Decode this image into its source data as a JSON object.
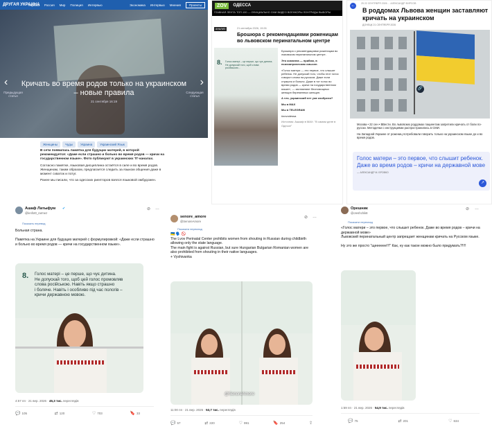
{
  "panel_a": {
    "nav": [
      "Україна",
      "Россия",
      "Мир",
      "Полиция",
      "Интервью"
    ],
    "logo": "ДРУГАЯ УКРАИНА",
    "nav_right": [
      "Экономика",
      "Интервью",
      "Мнения"
    ],
    "nav_button": "Проекты",
    "hero_title": "Кричать во время родов только на украинском – новые правила",
    "hero_date": "21 сентября 16:19",
    "prev_label": "Предыдущая статья",
    "next_label": "Следующая статья",
    "tags": [
      "Женщины",
      "Чуды",
      "Украина",
      "Украинский Язык"
    ],
    "p1": "В сети появилась памятка для будущих матерей, в которой рекомендуется: «Даже если страшно и больно во время родов — кричи на государственном языке». Фото публикуют в украинских ТГ-каналах.",
    "p2": "Согласно памятке, языковая дисциплина остаётся в силе и во время родов. Женщинам, таким образом, предлагается следить за языком общения даже в момент схваток и потуг.",
    "p3": "Ранее мы писали, что за одесских риелторов взялся языковой омбудсмен."
  },
  "panel_b": {
    "brand": "ZOV",
    "city": "ОДЕССА",
    "ticker": "ГЛАВНАЯ ЛЕНТА ТОП-100 — ОФИЦИАЛЬНО СМИ ВИДЕО ВОЕНКОРЫ ЛОНГРИДЫ ВЫБОРЫ",
    "badge": "АНАЛИЗ",
    "meta": "21 сентября 2026, 19:26",
    "title": "Брошюра с рекомендациями роженицам во львовском перинатальном центре",
    "img_num": "8.",
    "img_text": "Голос матері – це перше, що чує дитина. Не допускай того, щоб слова російською...",
    "c1": "Брошюра с рекомендациями роженицам во львовском перинатальном центре.",
    "c2": "Это коммнна — прийом, в психиатрическом смысле.",
    "c3": "«Голос матери — это первое, что слышит ребенок. Не допускай того, чтобы этот голос говорил слова на русском. Даже если страшно и больно. Даже в тот голос во время родов — кричи на государственном языке», — заставляют беспомощных женщин беременных женщин.",
    "c4": "А что, украинский нет уже изобрели?",
    "c5": "Мы в MAX",
    "c6": "Мы в TELEGRAM",
    "c7": "#zovodessa",
    "c8": "Источник: Ашкаф в MAX: \"В самом деле в Одессе\""
  },
  "panel_c": {
    "header": "25 22 СЕНТЯБРЯ 2026 ... АЛЕКСАНДР ФИРСОВ",
    "title": "В роддомах Львова женщин заставляют кричать на украинском",
    "meta": "ДОНЕЦК 21 СЕНТЯБРЯ 2026",
    "t1": "Москва • 22 сен • ВВести. Во львовских роддомах пациентам запретили кричать от боли по-русски. Методички с инструкциями распространились в СМИ.",
    "t2": "На Западной Украине от рожениц потребовали говорить только на украинском языке до и во время родов.",
    "quote": "Голос матери – это первое, что слышит ребенок. Даже во время родов – кричи на державной мове",
    "author": "— АЛЕКСАНДР М. БРОВКО"
  },
  "tweet1": {
    "name": "Ашаф Латыфум",
    "handle": "@lenfot0_rarmez",
    "translated": "Показать перевод",
    "text": "Больная страна.\n\nПамятка на Украине для будущих матерей с формулировкой: «Даже если страшно и больно во время родов — кричи на государственном языке».",
    "image_num": "8.",
    "image_text": "Голос матері – це перше, що чує дитина.\nНе допускай того, щоб цей голос промовляв\nслова російською. Навіть якщо страшно\nі боляче. Навіть і особливо під час пологів –\nкричи державною мовою.",
    "time": "4:57 пп · 21 вер. 2026 · ",
    "views": "45,3 тис.",
    "views_label": " переглядів",
    "replies": "105",
    "retweets": "120",
    "likes": "703",
    "bookmarks": "33"
  },
  "tweet2": {
    "name": "senore_amore",
    "handle": "@SenoreAmore",
    "translated": "Показати переклад",
    "text": "🇺🇦 🗣️ 🚫\nThe Lvov Perinatal Center prohibits women from shouting in Russian during childbirth allowing only the state language.\nThe main fight is against Russian, but sure Hungarian Bulgarian Romanian women are also prohibited from shouting in their native languages.\n+ Vyshivanka",
    "watermark": "@SenoreAmore",
    "time": "11:00 пп · 21 вер. 2026 · ",
    "views": "53,7 тис.",
    "views_label": " переглядів",
    "replies": "57",
    "retweets": "220",
    "likes": "991",
    "bookmarks": "254"
  },
  "tweet3": {
    "name": "Орешник",
    "handle": "@oreshchik8",
    "translated": "Показати переклад",
    "text": "«Голос матери – это первое, что слышит ребенок. Даже во время родов – кричи на державной мове»\nЛьвовский перинатальный центр запрещает женщинам кричать на Русском языке.\n\nНу это же просто \"щееееее!!!\" Как, ну как такое можно было придумать?!!!!",
    "time": "1:59 пп · 21 вер. 2026 · ",
    "views": "54,9 тис.",
    "views_label": " переглядів",
    "replies": "75",
    "retweets": "201",
    "likes": "634",
    "bookmarks": ""
  },
  "icons": {
    "more": "more-icon",
    "grok": "grok-icon",
    "reply": "reply-icon",
    "retweet": "retweet-icon",
    "like": "like-icon",
    "bookmark": "bookmark-icon",
    "share": "share-icon"
  },
  "colors": {
    "brand_blue": "#1f5fae",
    "zov_green": "#7dbf3f",
    "link_blue": "#2b57d8"
  }
}
